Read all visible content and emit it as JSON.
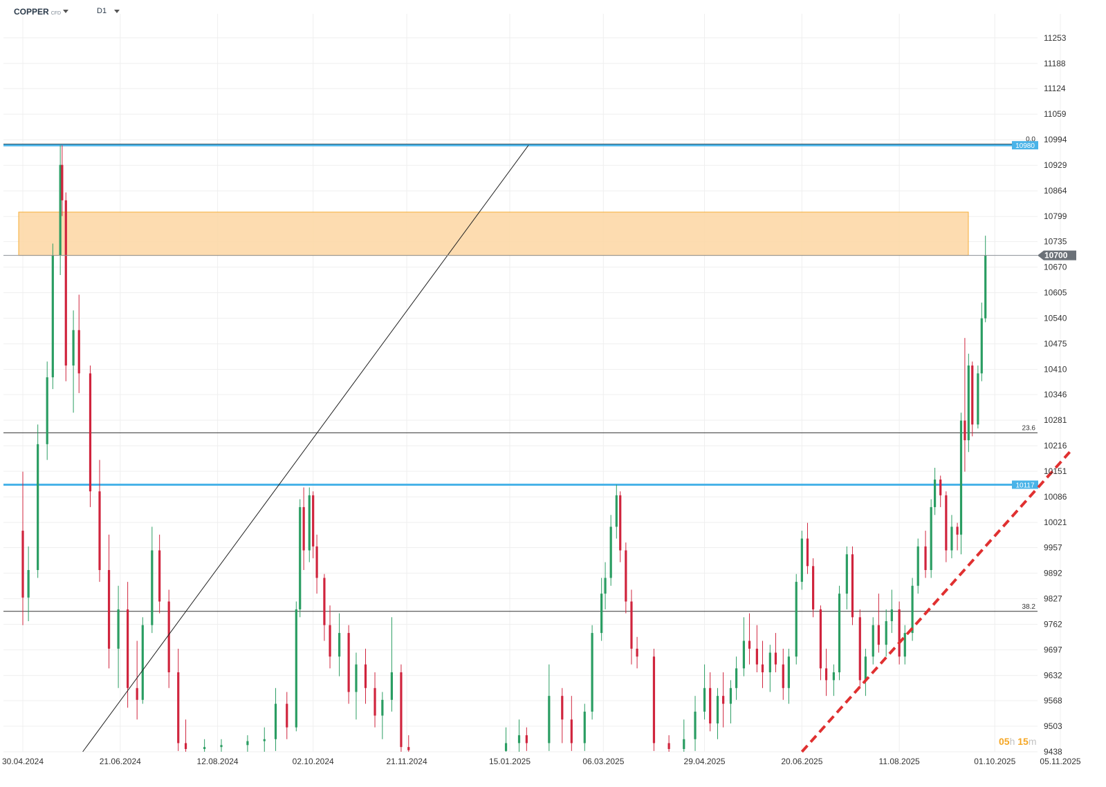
{
  "header": {
    "symbol": "COPPER",
    "instrument_type": "CFD",
    "timeframe": "D1"
  },
  "timer": {
    "hours": "05",
    "hours_unit": "h",
    "minutes": "15",
    "minutes_unit": "m"
  },
  "colors": {
    "up": "#2a9d62",
    "down": "#d0243d",
    "level": "#49b3e8",
    "zone": "#fdd9a8",
    "zone_border": "#f5a623",
    "trend": "#e03030",
    "grid": "#efefef"
  },
  "chart_data": {
    "type": "candlestick",
    "title": "",
    "xlabel": "",
    "ylabel": "",
    "ylim": [
      9438,
      11286
    ],
    "grid": true,
    "y_ticks": [
      11253,
      11188,
      11124,
      11059,
      10994,
      10929,
      10864,
      10799,
      10735,
      10670,
      10605,
      10540,
      10475,
      10410,
      10346,
      10281,
      10216,
      10151,
      10086,
      10021,
      9957,
      9892,
      9827,
      9762,
      9697,
      9632,
      9568,
      9503,
      9438
    ],
    "x_ticks": [
      "30.04.2024",
      "21.06.2024",
      "12.08.2024",
      "02.10.2024",
      "21.11.2024",
      "15.01.2025",
      "06.03.2025",
      "29.04.2025",
      "20.06.2025",
      "11.08.2025",
      "01.10.2025",
      "05.11.2025"
    ],
    "current_price": {
      "value": 10700,
      "label": "10700"
    },
    "horizontal_levels": [
      {
        "value": 10980,
        "label": "10980"
      },
      {
        "value": 10117,
        "label": "10117"
      }
    ],
    "fibonacci": [
      {
        "level": "0.0",
        "value": 10983
      },
      {
        "level": "23.6",
        "value": 10249
      },
      {
        "level": "38.2",
        "value": 9795
      }
    ],
    "resistance_zone": {
      "from_date": "2024-05-07",
      "to_date": "2025-11-05",
      "low": 10700,
      "high": 10810
    },
    "fib_line": {
      "from": [
        "2024-06-01",
        9438
      ],
      "to": [
        "2025-01-25",
        10980
      ]
    },
    "trendline": {
      "from": [
        "2025-06-20",
        9438
      ],
      "to": [
        "2025-11-10",
        10200
      ]
    },
    "candles": [
      {
        "d": "2024-04-30",
        "o": 10000,
        "h": 10150,
        "l": 9760,
        "c": 9830
      },
      {
        "d": "2024-05-03",
        "o": 9830,
        "h": 9960,
        "l": 9770,
        "c": 9900
      },
      {
        "d": "2024-05-08",
        "o": 9900,
        "h": 10270,
        "l": 9880,
        "c": 10220
      },
      {
        "d": "2024-05-13",
        "o": 10220,
        "h": 10430,
        "l": 10180,
        "c": 10390
      },
      {
        "d": "2024-05-16",
        "o": 10390,
        "h": 10730,
        "l": 10360,
        "c": 10700
      },
      {
        "d": "2024-05-20",
        "o": 10700,
        "h": 10980,
        "l": 10650,
        "c": 10930
      },
      {
        "d": "2024-05-21",
        "o": 10930,
        "h": 10980,
        "l": 10800,
        "c": 10840
      },
      {
        "d": "2024-05-23",
        "o": 10840,
        "h": 10860,
        "l": 10380,
        "c": 10420
      },
      {
        "d": "2024-05-27",
        "o": 10420,
        "h": 10560,
        "l": 10300,
        "c": 10510
      },
      {
        "d": "2024-05-30",
        "o": 10510,
        "h": 10600,
        "l": 10350,
        "c": 10400
      },
      {
        "d": "2024-06-05",
        "o": 10400,
        "h": 10420,
        "l": 10060,
        "c": 10100
      },
      {
        "d": "2024-06-10",
        "o": 10100,
        "h": 10180,
        "l": 9870,
        "c": 9900
      },
      {
        "d": "2024-06-15",
        "o": 9900,
        "h": 9990,
        "l": 9650,
        "c": 9700
      },
      {
        "d": "2024-06-20",
        "o": 9700,
        "h": 9860,
        "l": 9600,
        "c": 9800
      },
      {
        "d": "2024-06-25",
        "o": 9800,
        "h": 9870,
        "l": 9550,
        "c": 9600
      },
      {
        "d": "2024-06-30",
        "o": 9600,
        "h": 9720,
        "l": 9520,
        "c": 9570
      },
      {
        "d": "2024-07-03",
        "o": 9570,
        "h": 9780,
        "l": 9560,
        "c": 9760
      },
      {
        "d": "2024-07-08",
        "o": 9760,
        "h": 10010,
        "l": 9740,
        "c": 9950
      },
      {
        "d": "2024-07-12",
        "o": 9950,
        "h": 9990,
        "l": 9790,
        "c": 9820
      },
      {
        "d": "2024-07-17",
        "o": 9820,
        "h": 9850,
        "l": 9600,
        "c": 9640
      },
      {
        "d": "2024-07-22",
        "o": 9640,
        "h": 9700,
        "l": 9440,
        "c": 9460
      },
      {
        "d": "2024-07-26",
        "o": 9460,
        "h": 9520,
        "l": 9438,
        "c": 9445
      },
      {
        "d": "2024-08-05",
        "o": 9445,
        "h": 9470,
        "l": 9438,
        "c": 9450
      },
      {
        "d": "2024-08-14",
        "o": 9450,
        "h": 9470,
        "l": 9438,
        "c": 9455
      },
      {
        "d": "2024-08-28",
        "o": 9455,
        "h": 9480,
        "l": 9438,
        "c": 9465
      },
      {
        "d": "2024-09-06",
        "o": 9465,
        "h": 9500,
        "l": 9438,
        "c": 9470
      },
      {
        "d": "2024-09-12",
        "o": 9470,
        "h": 9600,
        "l": 9440,
        "c": 9560
      },
      {
        "d": "2024-09-18",
        "o": 9560,
        "h": 9590,
        "l": 9470,
        "c": 9500
      },
      {
        "d": "2024-09-23",
        "o": 9500,
        "h": 9820,
        "l": 9490,
        "c": 9800
      },
      {
        "d": "2024-09-25",
        "o": 9800,
        "h": 10080,
        "l": 9780,
        "c": 10060
      },
      {
        "d": "2024-09-27",
        "o": 10060,
        "h": 10110,
        "l": 9900,
        "c": 9950
      },
      {
        "d": "2024-09-30",
        "o": 9950,
        "h": 10110,
        "l": 9920,
        "c": 10090
      },
      {
        "d": "2024-10-02",
        "o": 10090,
        "h": 10100,
        "l": 9930,
        "c": 9960
      },
      {
        "d": "2024-10-04",
        "o": 9960,
        "h": 9990,
        "l": 9840,
        "c": 9880
      },
      {
        "d": "2024-10-08",
        "o": 9880,
        "h": 9890,
        "l": 9720,
        "c": 9760
      },
      {
        "d": "2024-10-11",
        "o": 9760,
        "h": 9810,
        "l": 9650,
        "c": 9680
      },
      {
        "d": "2024-10-16",
        "o": 9680,
        "h": 9790,
        "l": 9630,
        "c": 9740
      },
      {
        "d": "2024-10-21",
        "o": 9740,
        "h": 9760,
        "l": 9560,
        "c": 9590
      },
      {
        "d": "2024-10-25",
        "o": 9590,
        "h": 9690,
        "l": 9520,
        "c": 9660
      },
      {
        "d": "2024-10-30",
        "o": 9660,
        "h": 9700,
        "l": 9560,
        "c": 9600
      },
      {
        "d": "2024-11-04",
        "o": 9600,
        "h": 9640,
        "l": 9500,
        "c": 9530
      },
      {
        "d": "2024-11-08",
        "o": 9530,
        "h": 9590,
        "l": 9470,
        "c": 9570
      },
      {
        "d": "2024-11-13",
        "o": 9570,
        "h": 9780,
        "l": 9540,
        "c": 9640
      },
      {
        "d": "2024-11-18",
        "o": 9640,
        "h": 9660,
        "l": 9438,
        "c": 9450
      },
      {
        "d": "2024-11-22",
        "o": 9450,
        "h": 9480,
        "l": 9438,
        "c": 9442
      },
      {
        "d": "2025-01-13",
        "o": 9440,
        "h": 9500,
        "l": 9438,
        "c": 9460
      },
      {
        "d": "2025-01-20",
        "o": 9460,
        "h": 9520,
        "l": 9438,
        "c": 9480
      },
      {
        "d": "2025-01-24",
        "o": 9480,
        "h": 9500,
        "l": 9440,
        "c": 9460
      },
      {
        "d": "2025-02-05",
        "o": 9460,
        "h": 9660,
        "l": 9440,
        "c": 9580
      },
      {
        "d": "2025-02-12",
        "o": 9580,
        "h": 9600,
        "l": 9460,
        "c": 9520
      },
      {
        "d": "2025-02-17",
        "o": 9520,
        "h": 9580,
        "l": 9440,
        "c": 9460
      },
      {
        "d": "2025-02-24",
        "o": 9460,
        "h": 9560,
        "l": 9440,
        "c": 9540
      },
      {
        "d": "2025-02-28",
        "o": 9540,
        "h": 9760,
        "l": 9520,
        "c": 9740
      },
      {
        "d": "2025-03-05",
        "o": 9740,
        "h": 9880,
        "l": 9720,
        "c": 9840
      },
      {
        "d": "2025-03-07",
        "o": 9840,
        "h": 9920,
        "l": 9800,
        "c": 9880
      },
      {
        "d": "2025-03-10",
        "o": 9880,
        "h": 10040,
        "l": 9860,
        "c": 10010
      },
      {
        "d": "2025-03-13",
        "o": 10010,
        "h": 10117,
        "l": 9980,
        "c": 10090
      },
      {
        "d": "2025-03-15",
        "o": 10090,
        "h": 10100,
        "l": 9920,
        "c": 9950
      },
      {
        "d": "2025-03-18",
        "o": 9950,
        "h": 9970,
        "l": 9790,
        "c": 9820
      },
      {
        "d": "2025-03-21",
        "o": 9820,
        "h": 9850,
        "l": 9660,
        "c": 9700
      },
      {
        "d": "2025-03-24",
        "o": 9700,
        "h": 9730,
        "l": 9650,
        "c": 9680
      },
      {
        "d": "2025-04-02",
        "o": 9680,
        "h": 9700,
        "l": 9440,
        "c": 9460
      },
      {
        "d": "2025-04-10",
        "o": 9460,
        "h": 9480,
        "l": 9438,
        "c": 9445
      },
      {
        "d": "2025-04-18",
        "o": 9445,
        "h": 9520,
        "l": 9438,
        "c": 9470
      },
      {
        "d": "2025-04-24",
        "o": 9470,
        "h": 9580,
        "l": 9440,
        "c": 9540
      },
      {
        "d": "2025-04-29",
        "o": 9540,
        "h": 9660,
        "l": 9520,
        "c": 9600
      },
      {
        "d": "2025-05-02",
        "o": 9600,
        "h": 9640,
        "l": 9490,
        "c": 9510
      },
      {
        "d": "2025-05-06",
        "o": 9510,
        "h": 9600,
        "l": 9470,
        "c": 9580
      },
      {
        "d": "2025-05-09",
        "o": 9580,
        "h": 9640,
        "l": 9500,
        "c": 9560
      },
      {
        "d": "2025-05-13",
        "o": 9560,
        "h": 9620,
        "l": 9510,
        "c": 9600
      },
      {
        "d": "2025-05-16",
        "o": 9600,
        "h": 9680,
        "l": 9570,
        "c": 9650
      },
      {
        "d": "2025-05-20",
        "o": 9650,
        "h": 9780,
        "l": 9630,
        "c": 9720
      },
      {
        "d": "2025-05-23",
        "o": 9720,
        "h": 9790,
        "l": 9660,
        "c": 9700
      },
      {
        "d": "2025-05-27",
        "o": 9700,
        "h": 9760,
        "l": 9640,
        "c": 9660
      },
      {
        "d": "2025-05-30",
        "o": 9660,
        "h": 9720,
        "l": 9600,
        "c": 9640
      },
      {
        "d": "2025-06-03",
        "o": 9640,
        "h": 9710,
        "l": 9590,
        "c": 9690
      },
      {
        "d": "2025-06-06",
        "o": 9690,
        "h": 9740,
        "l": 9640,
        "c": 9660
      },
      {
        "d": "2025-06-10",
        "o": 9660,
        "h": 9700,
        "l": 9570,
        "c": 9600
      },
      {
        "d": "2025-06-13",
        "o": 9600,
        "h": 9700,
        "l": 9560,
        "c": 9680
      },
      {
        "d": "2025-06-17",
        "o": 9680,
        "h": 9890,
        "l": 9660,
        "c": 9870
      },
      {
        "d": "2025-06-20",
        "o": 9870,
        "h": 10000,
        "l": 9850,
        "c": 9980
      },
      {
        "d": "2025-06-23",
        "o": 9980,
        "h": 10020,
        "l": 9890,
        "c": 9910
      },
      {
        "d": "2025-06-26",
        "o": 9910,
        "h": 9930,
        "l": 9780,
        "c": 9800
      },
      {
        "d": "2025-06-30",
        "o": 9800,
        "h": 9810,
        "l": 9620,
        "c": 9650
      },
      {
        "d": "2025-07-03",
        "o": 9650,
        "h": 9700,
        "l": 9580,
        "c": 9620
      },
      {
        "d": "2025-07-07",
        "o": 9620,
        "h": 9660,
        "l": 9580,
        "c": 9640
      },
      {
        "d": "2025-07-10",
        "o": 9640,
        "h": 9860,
        "l": 9620,
        "c": 9840
      },
      {
        "d": "2025-07-14",
        "o": 9840,
        "h": 9960,
        "l": 9800,
        "c": 9940
      },
      {
        "d": "2025-07-17",
        "o": 9940,
        "h": 9960,
        "l": 9760,
        "c": 9780
      },
      {
        "d": "2025-07-21",
        "o": 9780,
        "h": 9800,
        "l": 9600,
        "c": 9620
      },
      {
        "d": "2025-07-24",
        "o": 9620,
        "h": 9700,
        "l": 9580,
        "c": 9680
      },
      {
        "d": "2025-07-28",
        "o": 9680,
        "h": 9780,
        "l": 9660,
        "c": 9760
      },
      {
        "d": "2025-07-31",
        "o": 9760,
        "h": 9840,
        "l": 9690,
        "c": 9710
      },
      {
        "d": "2025-08-04",
        "o": 9710,
        "h": 9800,
        "l": 9680,
        "c": 9770
      },
      {
        "d": "2025-08-07",
        "o": 9770,
        "h": 9850,
        "l": 9740,
        "c": 9800
      },
      {
        "d": "2025-08-11",
        "o": 9800,
        "h": 9820,
        "l": 9660,
        "c": 9680
      },
      {
        "d": "2025-08-14",
        "o": 9680,
        "h": 9760,
        "l": 9660,
        "c": 9740
      },
      {
        "d": "2025-08-18",
        "o": 9740,
        "h": 9880,
        "l": 9720,
        "c": 9860
      },
      {
        "d": "2025-08-21",
        "o": 9860,
        "h": 9980,
        "l": 9840,
        "c": 9960
      },
      {
        "d": "2025-08-25",
        "o": 9960,
        "h": 10000,
        "l": 9880,
        "c": 9900
      },
      {
        "d": "2025-08-28",
        "o": 9900,
        "h": 10080,
        "l": 9880,
        "c": 10060
      },
      {
        "d": "2025-08-30",
        "o": 10060,
        "h": 10160,
        "l": 10040,
        "c": 10130
      },
      {
        "d": "2025-09-02",
        "o": 10130,
        "h": 10140,
        "l": 10060,
        "c": 10090
      },
      {
        "d": "2025-09-05",
        "o": 10090,
        "h": 10100,
        "l": 9920,
        "c": 9950
      },
      {
        "d": "2025-09-08",
        "o": 9950,
        "h": 10040,
        "l": 9930,
        "c": 10010
      },
      {
        "d": "2025-09-11",
        "o": 10010,
        "h": 10020,
        "l": 9950,
        "c": 9990
      },
      {
        "d": "2025-09-13",
        "o": 9990,
        "h": 10300,
        "l": 9940,
        "c": 10280
      },
      {
        "d": "2025-09-15",
        "o": 10280,
        "h": 10490,
        "l": 10150,
        "c": 10230
      },
      {
        "d": "2025-09-17",
        "o": 10230,
        "h": 10450,
        "l": 10200,
        "c": 10420
      },
      {
        "d": "2025-09-19",
        "o": 10420,
        "h": 10430,
        "l": 10240,
        "c": 10270
      },
      {
        "d": "2025-09-22",
        "o": 10270,
        "h": 10420,
        "l": 10260,
        "c": 10400
      },
      {
        "d": "2025-09-24",
        "o": 10400,
        "h": 10580,
        "l": 10380,
        "c": 10540
      },
      {
        "d": "2025-09-26",
        "o": 10540,
        "h": 10750,
        "l": 10530,
        "c": 10700
      }
    ]
  }
}
